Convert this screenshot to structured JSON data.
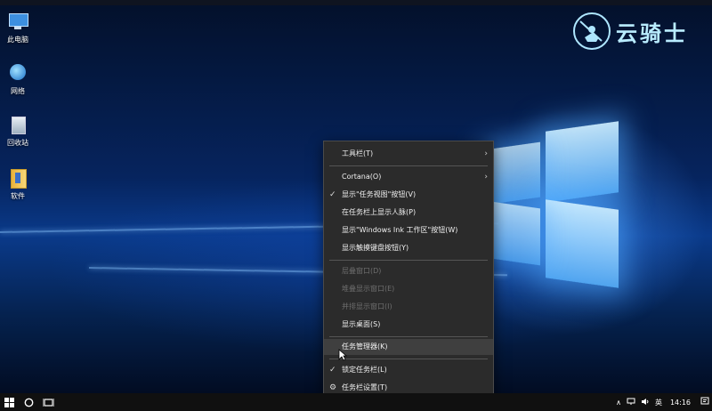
{
  "desktop": {
    "icons": [
      {
        "label": "此电脑",
        "icon": "computer-icon"
      },
      {
        "label": "网络",
        "icon": "network-icon"
      },
      {
        "label": "回收站",
        "icon": "recycle-bin-icon"
      },
      {
        "label": "软件",
        "icon": "folder-icon"
      }
    ]
  },
  "brand": {
    "text": "云骑士",
    "icon": "knight-logo-icon"
  },
  "context_menu": {
    "items": [
      {
        "label": "工具栏(T)",
        "submenu": true,
        "enabled": true
      },
      {
        "label": "Cortana(O)",
        "submenu": true,
        "enabled": true
      },
      {
        "label": "显示\"任务视图\"按钮(V)",
        "checked": true,
        "enabled": true
      },
      {
        "label": "在任务栏上显示人脉(P)",
        "enabled": true
      },
      {
        "label": "显示\"Windows Ink 工作区\"按钮(W)",
        "enabled": true
      },
      {
        "label": "显示触摸键盘按钮(Y)",
        "enabled": true
      },
      {
        "label": "层叠窗口(D)",
        "enabled": false
      },
      {
        "label": "堆叠显示窗口(E)",
        "enabled": false
      },
      {
        "label": "并排显示窗口(I)",
        "enabled": false
      },
      {
        "label": "显示桌面(S)",
        "enabled": true
      },
      {
        "label": "任务管理器(K)",
        "enabled": true,
        "hovered": true
      },
      {
        "label": "锁定任务栏(L)",
        "checked": true,
        "enabled": true
      },
      {
        "label": "任务栏设置(T)",
        "icon": "gear-icon",
        "enabled": true
      }
    ],
    "check_glyph": "✓",
    "arrow_glyph": "›",
    "gear_glyph": "⚙"
  },
  "taskbar": {
    "tray": {
      "chevron": "∧",
      "ime": "英",
      "time": "14:16"
    }
  }
}
